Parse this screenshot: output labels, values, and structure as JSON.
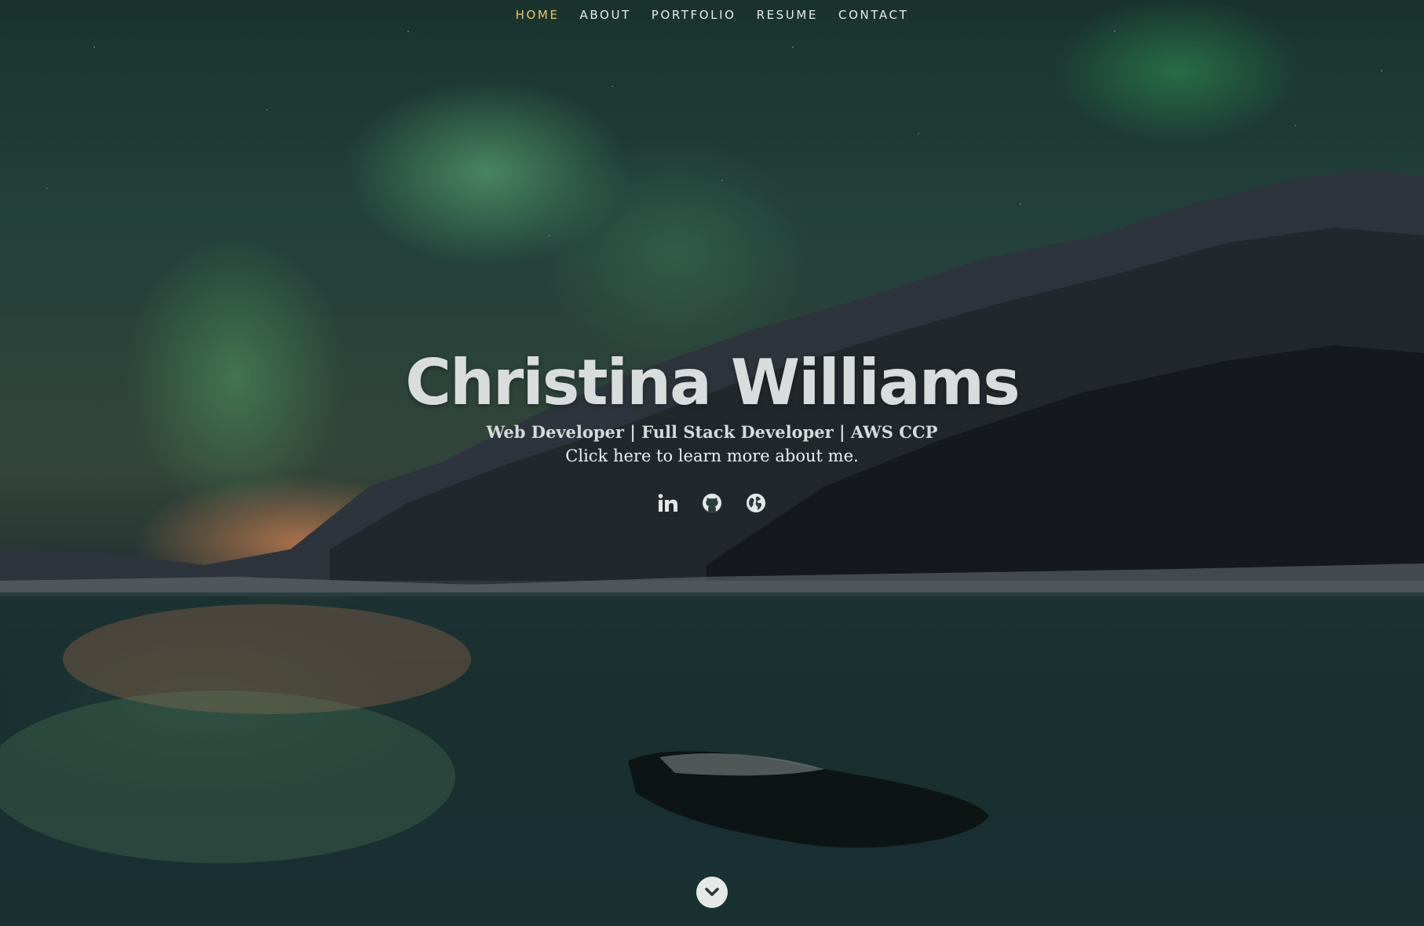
{
  "nav": {
    "items": [
      {
        "label": "HOME",
        "active": true
      },
      {
        "label": "ABOUT",
        "active": false
      },
      {
        "label": "PORTFOLIO",
        "active": false
      },
      {
        "label": "RESUME",
        "active": false
      },
      {
        "label": "CONTACT",
        "active": false
      }
    ],
    "active_color": "#e6c66a"
  },
  "banner": {
    "name": "Christina Williams",
    "subtitle": "Web Developer | Full Stack Developer | AWS CCP",
    "about_link": "Click here to learn more about me."
  },
  "social": {
    "icons": [
      "linkedin-icon",
      "github-icon",
      "globe-icon"
    ]
  },
  "scroll": {
    "icon": "chevron-down-icon"
  }
}
